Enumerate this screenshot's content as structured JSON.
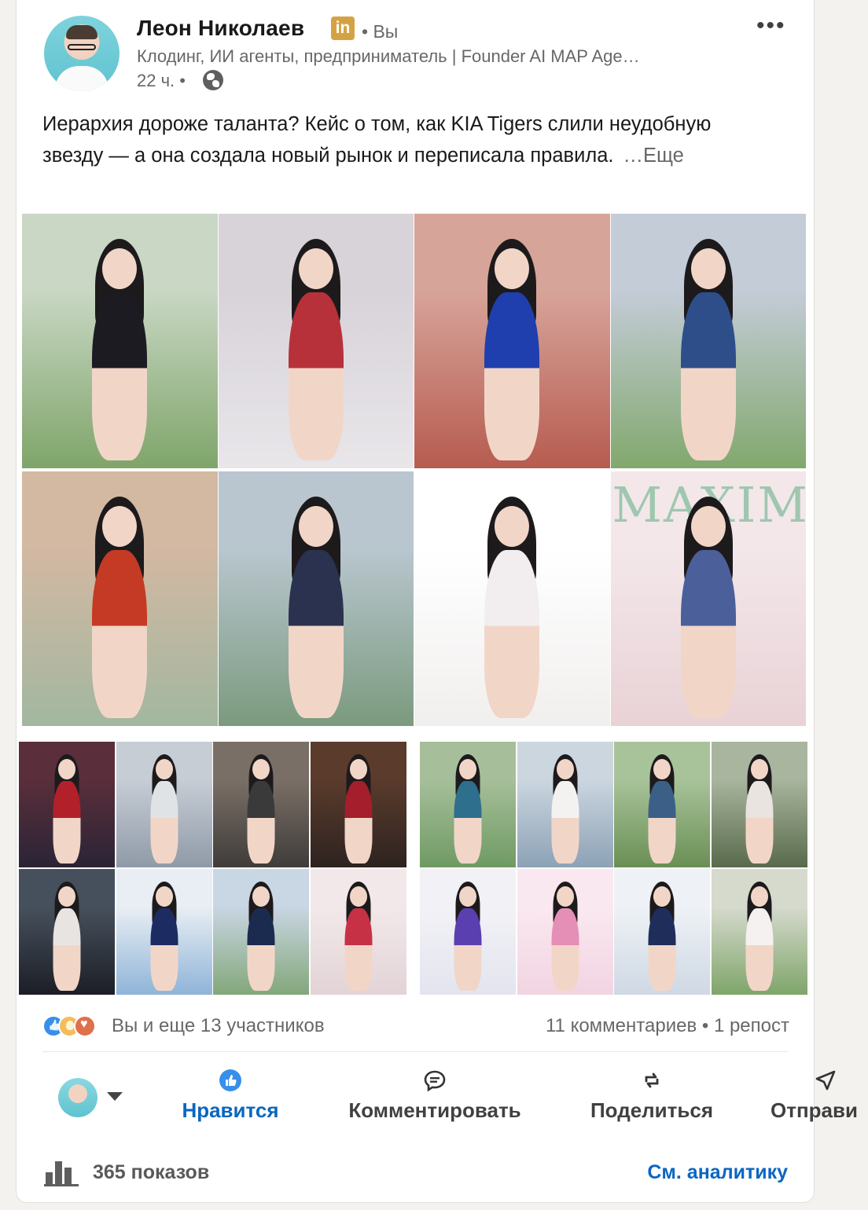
{
  "author": {
    "name": "Леон Николаев",
    "badge": "in",
    "you_label": "• Вы",
    "headline": "Клодинг, ИИ агенты, предприниматель | Founder AI MAP Age…",
    "time": "22 ч. •"
  },
  "post": {
    "text": "Иерархия дороже таланта? Кейс о том, как KIA Tigers слили неудобную звезду — а она создала новый рынок и переписала правила.",
    "see_more": "…Еще"
  },
  "gallery": {
    "photos_count": 24,
    "magazine_text": "MAXIM"
  },
  "engagement": {
    "reactions_text": "Вы и еще 13 участников",
    "comments_text": "11 комментариев • 1 репост"
  },
  "actions": {
    "like": "Нравится",
    "comment": "Комментировать",
    "share": "Поделиться",
    "send": "Отправи"
  },
  "footer": {
    "views": "365 показов",
    "analytics": "См. аналитику"
  },
  "colors": {
    "accent": "#0a66c2",
    "badge": "#d5a243"
  }
}
